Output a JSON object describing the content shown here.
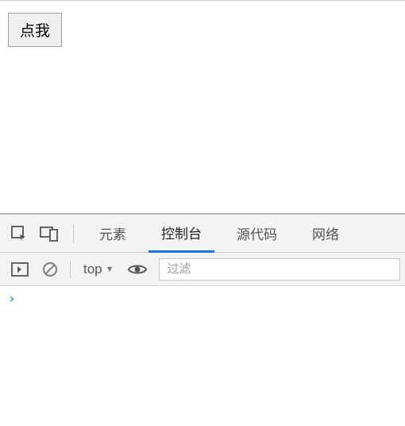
{
  "page": {
    "button_label": "点我"
  },
  "devtools": {
    "tabs": [
      {
        "label": "元素"
      },
      {
        "label": "控制台"
      },
      {
        "label": "源代码"
      },
      {
        "label": "网络"
      }
    ],
    "active_tab_index": 1,
    "console": {
      "context": "top",
      "filter_placeholder": "过滤",
      "prompt": "›"
    }
  }
}
